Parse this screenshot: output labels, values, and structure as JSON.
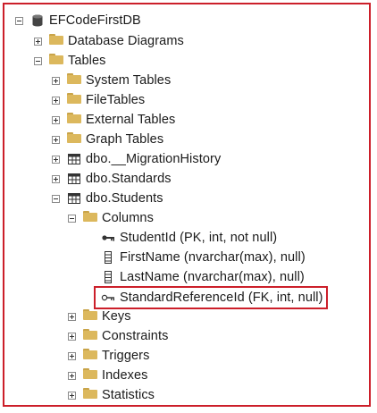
{
  "tree": {
    "database": "EFCodeFirstDB",
    "nodes": {
      "database_diagrams": "Database Diagrams",
      "tables": "Tables",
      "system_tables": "System Tables",
      "file_tables": "FileTables",
      "external_tables": "External Tables",
      "graph_tables": "Graph Tables",
      "migration_history": "dbo.__MigrationHistory",
      "standards": "dbo.Standards",
      "students": "dbo.Students",
      "columns": "Columns",
      "col_student_id": "StudentId (PK, int, not null)",
      "col_first_name": "FirstName (nvarchar(max), null)",
      "col_last_name": "LastName (nvarchar(max), null)",
      "col_standard_ref": "StandardReferenceId (FK, int, null)",
      "keys": "Keys",
      "constraints": "Constraints",
      "triggers": "Triggers",
      "indexes": "Indexes",
      "statistics": "Statistics"
    }
  },
  "colors": {
    "highlight_border": "#cc1f2a",
    "folder": "#dcb85d"
  }
}
